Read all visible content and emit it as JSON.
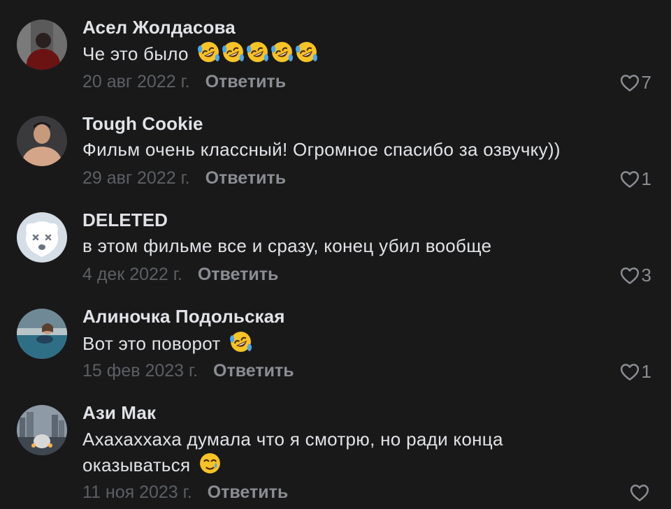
{
  "comments": [
    {
      "author": "Асел Жолдасова",
      "text": "Че это было",
      "emojis": [
        "rofl-emoji",
        "rofl-emoji",
        "rofl-emoji",
        "rofl-emoji",
        "rofl-emoji"
      ],
      "date": "20 авг 2022 г.",
      "reply_label": "Ответить",
      "likes": "7"
    },
    {
      "author": "Tough Cookie",
      "text": "Фильм очень классный! Огромное спасибо за озвучку))",
      "emojis": [],
      "date": "29 авг 2022 г.",
      "reply_label": "Ответить",
      "likes": "1"
    },
    {
      "author": "DELETED",
      "text": "в этом фильме все и сразу, конец убил вообще",
      "emojis": [],
      "date": "4 дек 2022 г.",
      "reply_label": "Ответить",
      "likes": "3"
    },
    {
      "author": "Алиночка Подольская",
      "text": "Вот это поворот",
      "emojis": [
        "rofl-emoji"
      ],
      "date": "15 фев 2023 г.",
      "reply_label": "Ответить",
      "likes": "1"
    },
    {
      "author": "Ази Мак",
      "text": "Ахахаххаха думала что я смотрю, но ради конца оказываться",
      "emojis": [
        "tear-smile-emoji"
      ],
      "date": "11 ноя 2023 г.",
      "reply_label": "Ответить",
      "likes": ""
    }
  ],
  "icons": {
    "like": "heart-outline-icon"
  },
  "colors": {
    "background": "#19191a",
    "text": "#e1e3e6",
    "secondary": "#8a8d91",
    "date": "#5c5f63"
  }
}
